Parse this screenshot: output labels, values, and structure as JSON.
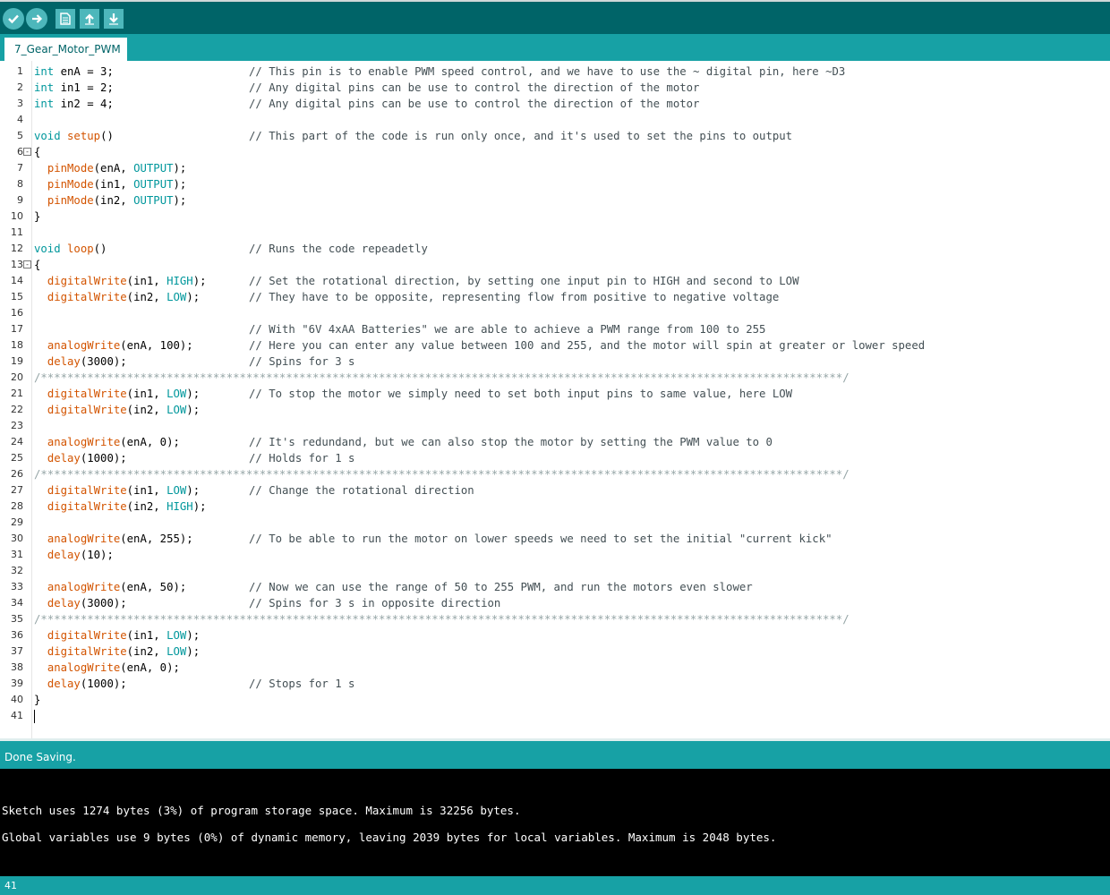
{
  "toolbar": {
    "buttons": [
      {
        "name": "verify",
        "icon": "check-icon"
      },
      {
        "name": "upload",
        "icon": "arrow-right-icon"
      },
      {
        "name": "new",
        "icon": "new-file-icon"
      },
      {
        "name": "open",
        "icon": "arrow-up-icon"
      },
      {
        "name": "save",
        "icon": "arrow-down-icon"
      }
    ]
  },
  "tab": {
    "label": "7_Gear_Motor_PWM"
  },
  "code": {
    "lines": [
      {
        "n": "1",
        "code": "int enA = 3;",
        "comment": "// This pin is to enable PWM speed control, and we have to use the ~ digital pin, here ~D3"
      },
      {
        "n": "2",
        "code": "int in1 = 2;",
        "comment": "// Any digital pins can be use to control the direction of the motor"
      },
      {
        "n": "3",
        "code": "int in2 = 4;",
        "comment": "// Any digital pins can be use to control the direction of the motor"
      },
      {
        "n": "4",
        "code": "",
        "comment": ""
      },
      {
        "n": "5",
        "code": "void setup()",
        "comment": "// This part of the code is run only once, and it's used to set the pins to output"
      },
      {
        "n": "6",
        "code": "{",
        "comment": "",
        "fold": true
      },
      {
        "n": "7",
        "code": "  pinMode(enA, OUTPUT);",
        "comment": ""
      },
      {
        "n": "8",
        "code": "  pinMode(in1, OUTPUT);",
        "comment": ""
      },
      {
        "n": "9",
        "code": "  pinMode(in2, OUTPUT);",
        "comment": ""
      },
      {
        "n": "10",
        "code": "}",
        "comment": ""
      },
      {
        "n": "11",
        "code": "",
        "comment": ""
      },
      {
        "n": "12",
        "code": "void loop()",
        "comment": "// Runs the code repeadetly"
      },
      {
        "n": "13",
        "code": "{",
        "comment": "",
        "fold": true
      },
      {
        "n": "14",
        "code": "  digitalWrite(in1, HIGH);",
        "comment": "// Set the rotational direction, by setting one input pin to HIGH and second to LOW"
      },
      {
        "n": "15",
        "code": "  digitalWrite(in2, LOW);",
        "comment": "// They have to be opposite, representing flow from positive to negative voltage"
      },
      {
        "n": "16",
        "code": "",
        "comment": ""
      },
      {
        "n": "17",
        "code": "",
        "comment": "// With \"6V 4xAA Batteries\" we are able to achieve a PWM range from 100 to 255"
      },
      {
        "n": "18",
        "code": "  analogWrite(enA, 100);",
        "comment": "// Here you can enter any value between 100 and 255, and the motor will spin at greater or lower speed"
      },
      {
        "n": "19",
        "code": "  delay(3000);",
        "comment": "// Spins for 3 s"
      },
      {
        "n": "20",
        "code": "/*************************************************************************************************************************/",
        "comment": "",
        "sep": true
      },
      {
        "n": "21",
        "code": "  digitalWrite(in1, LOW);",
        "comment": "// To stop the motor we simply need to set both input pins to same value, here LOW"
      },
      {
        "n": "22",
        "code": "  digitalWrite(in2, LOW);",
        "comment": ""
      },
      {
        "n": "23",
        "code": "",
        "comment": ""
      },
      {
        "n": "24",
        "code": "  analogWrite(enA, 0);",
        "comment": "// It's redundand, but we can also stop the motor by setting the PWM value to 0"
      },
      {
        "n": "25",
        "code": "  delay(1000);",
        "comment": "// Holds for 1 s"
      },
      {
        "n": "26",
        "code": "/*************************************************************************************************************************/",
        "comment": "",
        "sep": true
      },
      {
        "n": "27",
        "code": "  digitalWrite(in1, LOW);",
        "comment": "// Change the rotational direction"
      },
      {
        "n": "28",
        "code": "  digitalWrite(in2, HIGH);",
        "comment": ""
      },
      {
        "n": "29",
        "code": "",
        "comment": ""
      },
      {
        "n": "30",
        "code": "  analogWrite(enA, 255);",
        "comment": "// To be able to run the motor on lower speeds we need to set the initial \"current kick\""
      },
      {
        "n": "31",
        "code": "  delay(10);",
        "comment": ""
      },
      {
        "n": "32",
        "code": "",
        "comment": ""
      },
      {
        "n": "33",
        "code": "  analogWrite(enA, 50);",
        "comment": "// Now we can use the range of 50 to 255 PWM, and run the motors even slower"
      },
      {
        "n": "34",
        "code": "  delay(3000);",
        "comment": "// Spins for 3 s in opposite direction"
      },
      {
        "n": "35",
        "code": "/*************************************************************************************************************************/",
        "comment": "",
        "sep": true
      },
      {
        "n": "36",
        "code": "  digitalWrite(in1, LOW);",
        "comment": ""
      },
      {
        "n": "37",
        "code": "  digitalWrite(in2, LOW);",
        "comment": ""
      },
      {
        "n": "38",
        "code": "  analogWrite(enA, 0);",
        "comment": ""
      },
      {
        "n": "39",
        "code": "  delay(1000);",
        "comment": "// Stops for 1 s"
      },
      {
        "n": "40",
        "code": "}",
        "comment": ""
      },
      {
        "n": "41",
        "code": "",
        "comment": "",
        "cursor": true
      }
    ]
  },
  "status": {
    "message": "Done Saving."
  },
  "console": {
    "lines": [
      "Sketch uses 1274 bytes (3%) of program storage space. Maximum is 32256 bytes.",
      "Global variables use 9 bytes (0%) of dynamic memory, leaving 2039 bytes for local variables. Maximum is 2048 bytes."
    ]
  },
  "footer": {
    "line_number": "41"
  },
  "colors": {
    "toolbar": "#006468",
    "tabbar": "#17a1a5",
    "keyword": "#00979c",
    "function": "#d35400",
    "comment": "#434f54"
  }
}
